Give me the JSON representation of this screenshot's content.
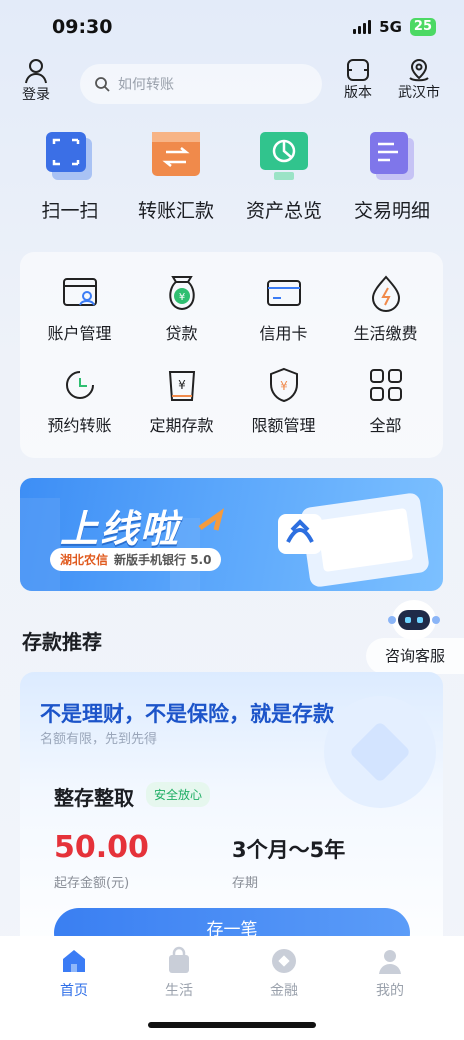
{
  "status": {
    "time": "09:30",
    "network": "5G",
    "battery": "25"
  },
  "header": {
    "login_label": "登录",
    "search_placeholder": "如何转账",
    "version_label": "版本",
    "location_label": "武汉市"
  },
  "features": [
    {
      "label": "扫一扫",
      "icon": "scan-icon"
    },
    {
      "label": "转账汇款",
      "icon": "transfer-icon"
    },
    {
      "label": "资产总览",
      "icon": "assets-icon"
    },
    {
      "label": "交易明细",
      "icon": "transactions-icon"
    }
  ],
  "grid": [
    {
      "label": "账户管理",
      "icon": "account-icon"
    },
    {
      "label": "贷款",
      "icon": "loan-icon"
    },
    {
      "label": "信用卡",
      "icon": "credit-card-icon"
    },
    {
      "label": "生活缴费",
      "icon": "utility-icon"
    },
    {
      "label": "预约转账",
      "icon": "scheduled-transfer-icon"
    },
    {
      "label": "定期存款",
      "icon": "fixed-deposit-icon"
    },
    {
      "label": "限额管理",
      "icon": "limit-icon"
    },
    {
      "label": "全部",
      "icon": "all-icon"
    }
  ],
  "banner": {
    "title": "上线啦",
    "bank": "湖北农信",
    "subtitle": "新版手机银行 5.0"
  },
  "section_title": "存款推荐",
  "robot_label": "咨询客服",
  "deposit": {
    "headline": "不是理财，不是保险，就是存款",
    "subline": "名额有限，先到先得",
    "product": "整存整取",
    "tag": "安全放心",
    "amount": "50.00",
    "amount_label": "起存金额(元)",
    "term": "3个月～5年",
    "term_label": "存期",
    "button": "存一笔"
  },
  "tabs": [
    {
      "label": "首页",
      "active": true
    },
    {
      "label": "生活",
      "active": false
    },
    {
      "label": "金融",
      "active": false
    },
    {
      "label": "我的",
      "active": false
    }
  ],
  "colors": {
    "accent": "#3a7ff2",
    "amount_red": "#e5323a",
    "tag_green": "#1fae65"
  }
}
